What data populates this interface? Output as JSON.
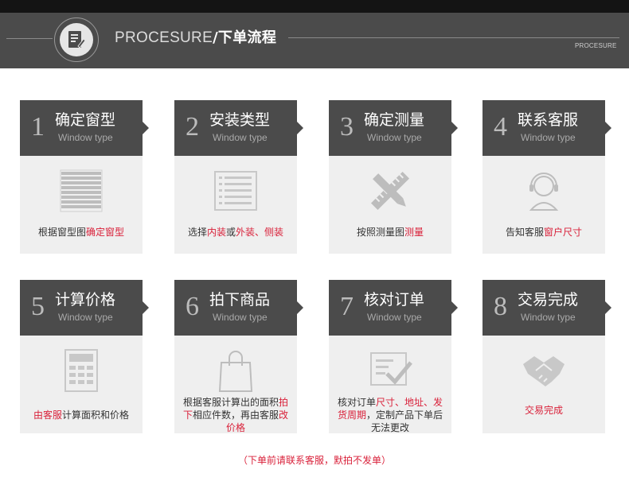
{
  "header": {
    "title_en": "PROCESURE",
    "title_cn": "/下单流程",
    "small_label": "PROCESURE",
    "icon": "document-edit-icon"
  },
  "steps": [
    {
      "num": "1",
      "title": "确定窗型",
      "sub": "Window type",
      "icon": "blind-icon",
      "desc": [
        {
          "t": "根据窗型图",
          "red": false
        },
        {
          "t": "确定窗型",
          "red": true
        }
      ]
    },
    {
      "num": "2",
      "title": "安装类型",
      "sub": "Window type",
      "icon": "list-icon",
      "desc": [
        {
          "t": "选择",
          "red": false
        },
        {
          "t": "内装",
          "red": true
        },
        {
          "t": "或",
          "red": false
        },
        {
          "t": "外装、侧装",
          "red": true
        }
      ]
    },
    {
      "num": "3",
      "title": "确定测量",
      "sub": "Window type",
      "icon": "ruler-pencil-icon",
      "desc": [
        {
          "t": "按照测量图",
          "red": false
        },
        {
          "t": "测量",
          "red": true
        }
      ]
    },
    {
      "num": "4",
      "title": "联系客服",
      "sub": "Window type",
      "icon": "customer-service-icon",
      "desc": [
        {
          "t": "告知客服",
          "red": false
        },
        {
          "t": "窗户尺寸",
          "red": true
        }
      ]
    },
    {
      "num": "5",
      "title": "计算价格",
      "sub": "Window type",
      "icon": "calculator-icon",
      "desc": [
        {
          "t": "由客服",
          "red": true
        },
        {
          "t": "计算面积和价格",
          "red": false
        }
      ]
    },
    {
      "num": "6",
      "title": "拍下商品",
      "sub": "Window type",
      "icon": "shopping-bag-icon",
      "desc": [
        {
          "t": "根据客服计算出的面积",
          "red": false
        },
        {
          "t": "拍下",
          "red": true
        },
        {
          "t": "相应件数，再由客服",
          "red": false
        },
        {
          "t": "改价格",
          "red": true
        }
      ]
    },
    {
      "num": "7",
      "title": "核对订单",
      "sub": "Window type",
      "icon": "order-check-icon",
      "desc": [
        {
          "t": "核对订单",
          "red": false
        },
        {
          "t": "尺寸、地址、发货周期",
          "red": true
        },
        {
          "t": "，定制产品下单后无法更改",
          "red": false
        }
      ]
    },
    {
      "num": "8",
      "title": "交易完成",
      "sub": "Window type",
      "icon": "handshake-icon",
      "desc": [
        {
          "t": "交易完成",
          "red": true
        }
      ]
    }
  ],
  "footer_note": "（下单前请联系客服，默拍不发单）"
}
